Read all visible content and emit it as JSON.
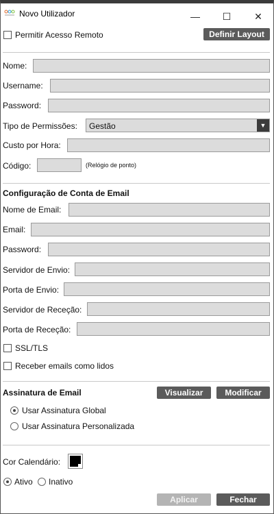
{
  "window": {
    "title": "Novo Utilizador",
    "minimize": "—",
    "maximize": "☐",
    "close": "✕"
  },
  "top": {
    "remote_access_label": "Permitir Acesso Remoto",
    "remote_access_checked": false,
    "layout_button": "Definir Layout"
  },
  "user": {
    "name_label": "Nome:",
    "name_value": "",
    "username_label": "Username:",
    "username_value": "",
    "password_label": "Password:",
    "password_value": "",
    "permissions_label": "Tipo de Permissões:",
    "permissions_value": "Gestão",
    "cost_label": "Custo por Hora:",
    "cost_value": "",
    "code_label": "Código:",
    "code_value": "",
    "code_note": "(Relógio de ponto)"
  },
  "email": {
    "section_title": "Configuração de Conta de Email",
    "email_name_label": "Nome de Email:",
    "email_label": "Email:",
    "password_label": "Password:",
    "send_server_label": "Servidor de Envio:",
    "send_port_label": "Porta de Envio:",
    "recv_server_label": "Servidor de Receção:",
    "recv_port_label": "Porta de Receção:",
    "ssl_label": "SSL/TLS",
    "ssl_checked": false,
    "read_label": "Receber emails como lidos",
    "read_checked": false
  },
  "signature": {
    "section_title": "Assinatura de Email",
    "view_button": "Visualizar",
    "modify_button": "Modificar",
    "global_label": "Usar Assinatura Global",
    "global_selected": true,
    "custom_label": "Usar Assinatura Personalizada",
    "custom_selected": false
  },
  "calendar": {
    "color_label": "Cor Calendário:",
    "color": "#000000"
  },
  "status": {
    "active_label": "Ativo",
    "active_selected": true,
    "inactive_label": "Inativo",
    "inactive_selected": false
  },
  "footer": {
    "apply_button": "Aplicar",
    "close_button": "Fechar"
  },
  "colors": {
    "button": "#5b5b5b",
    "button_disabled": "#b4b4b4",
    "field": "#dcdcdc",
    "titlebar_border": "#3b3b3b"
  }
}
